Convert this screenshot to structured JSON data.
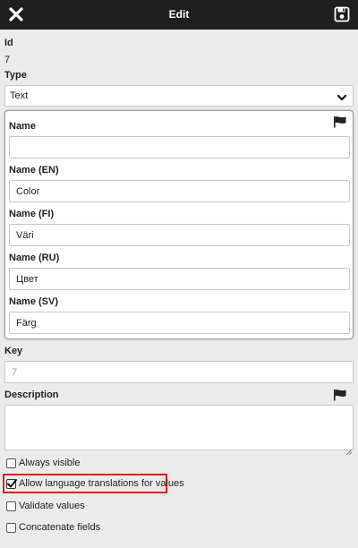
{
  "header": {
    "title": "Edit",
    "close_icon": "close-icon",
    "save_icon": "save-icon"
  },
  "form": {
    "id_label": "Id",
    "id_value": "7",
    "type_label": "Type",
    "type_value": "Text",
    "names": [
      {
        "label": "Name",
        "value": ""
      },
      {
        "label": "Name (EN)",
        "value": "Color"
      },
      {
        "label": "Name (FI)",
        "value": "Väri"
      },
      {
        "label": "Name (RU)",
        "value": "Цвет"
      },
      {
        "label": "Name (SV)",
        "value": "Färg"
      }
    ],
    "key_label": "Key",
    "key_placeholder": "7",
    "description_label": "Description",
    "description_value": "",
    "checkboxes": [
      {
        "label": "Always visible",
        "checked": false
      },
      {
        "label": "Allow language translations for values",
        "checked": true
      },
      {
        "label": "Validate values",
        "checked": false
      },
      {
        "label": "Concatenate fields",
        "checked": false
      }
    ]
  },
  "colors": {
    "header_bg": "#1f1f1f",
    "page_bg": "#ebebeb",
    "highlight": "#e02020"
  }
}
